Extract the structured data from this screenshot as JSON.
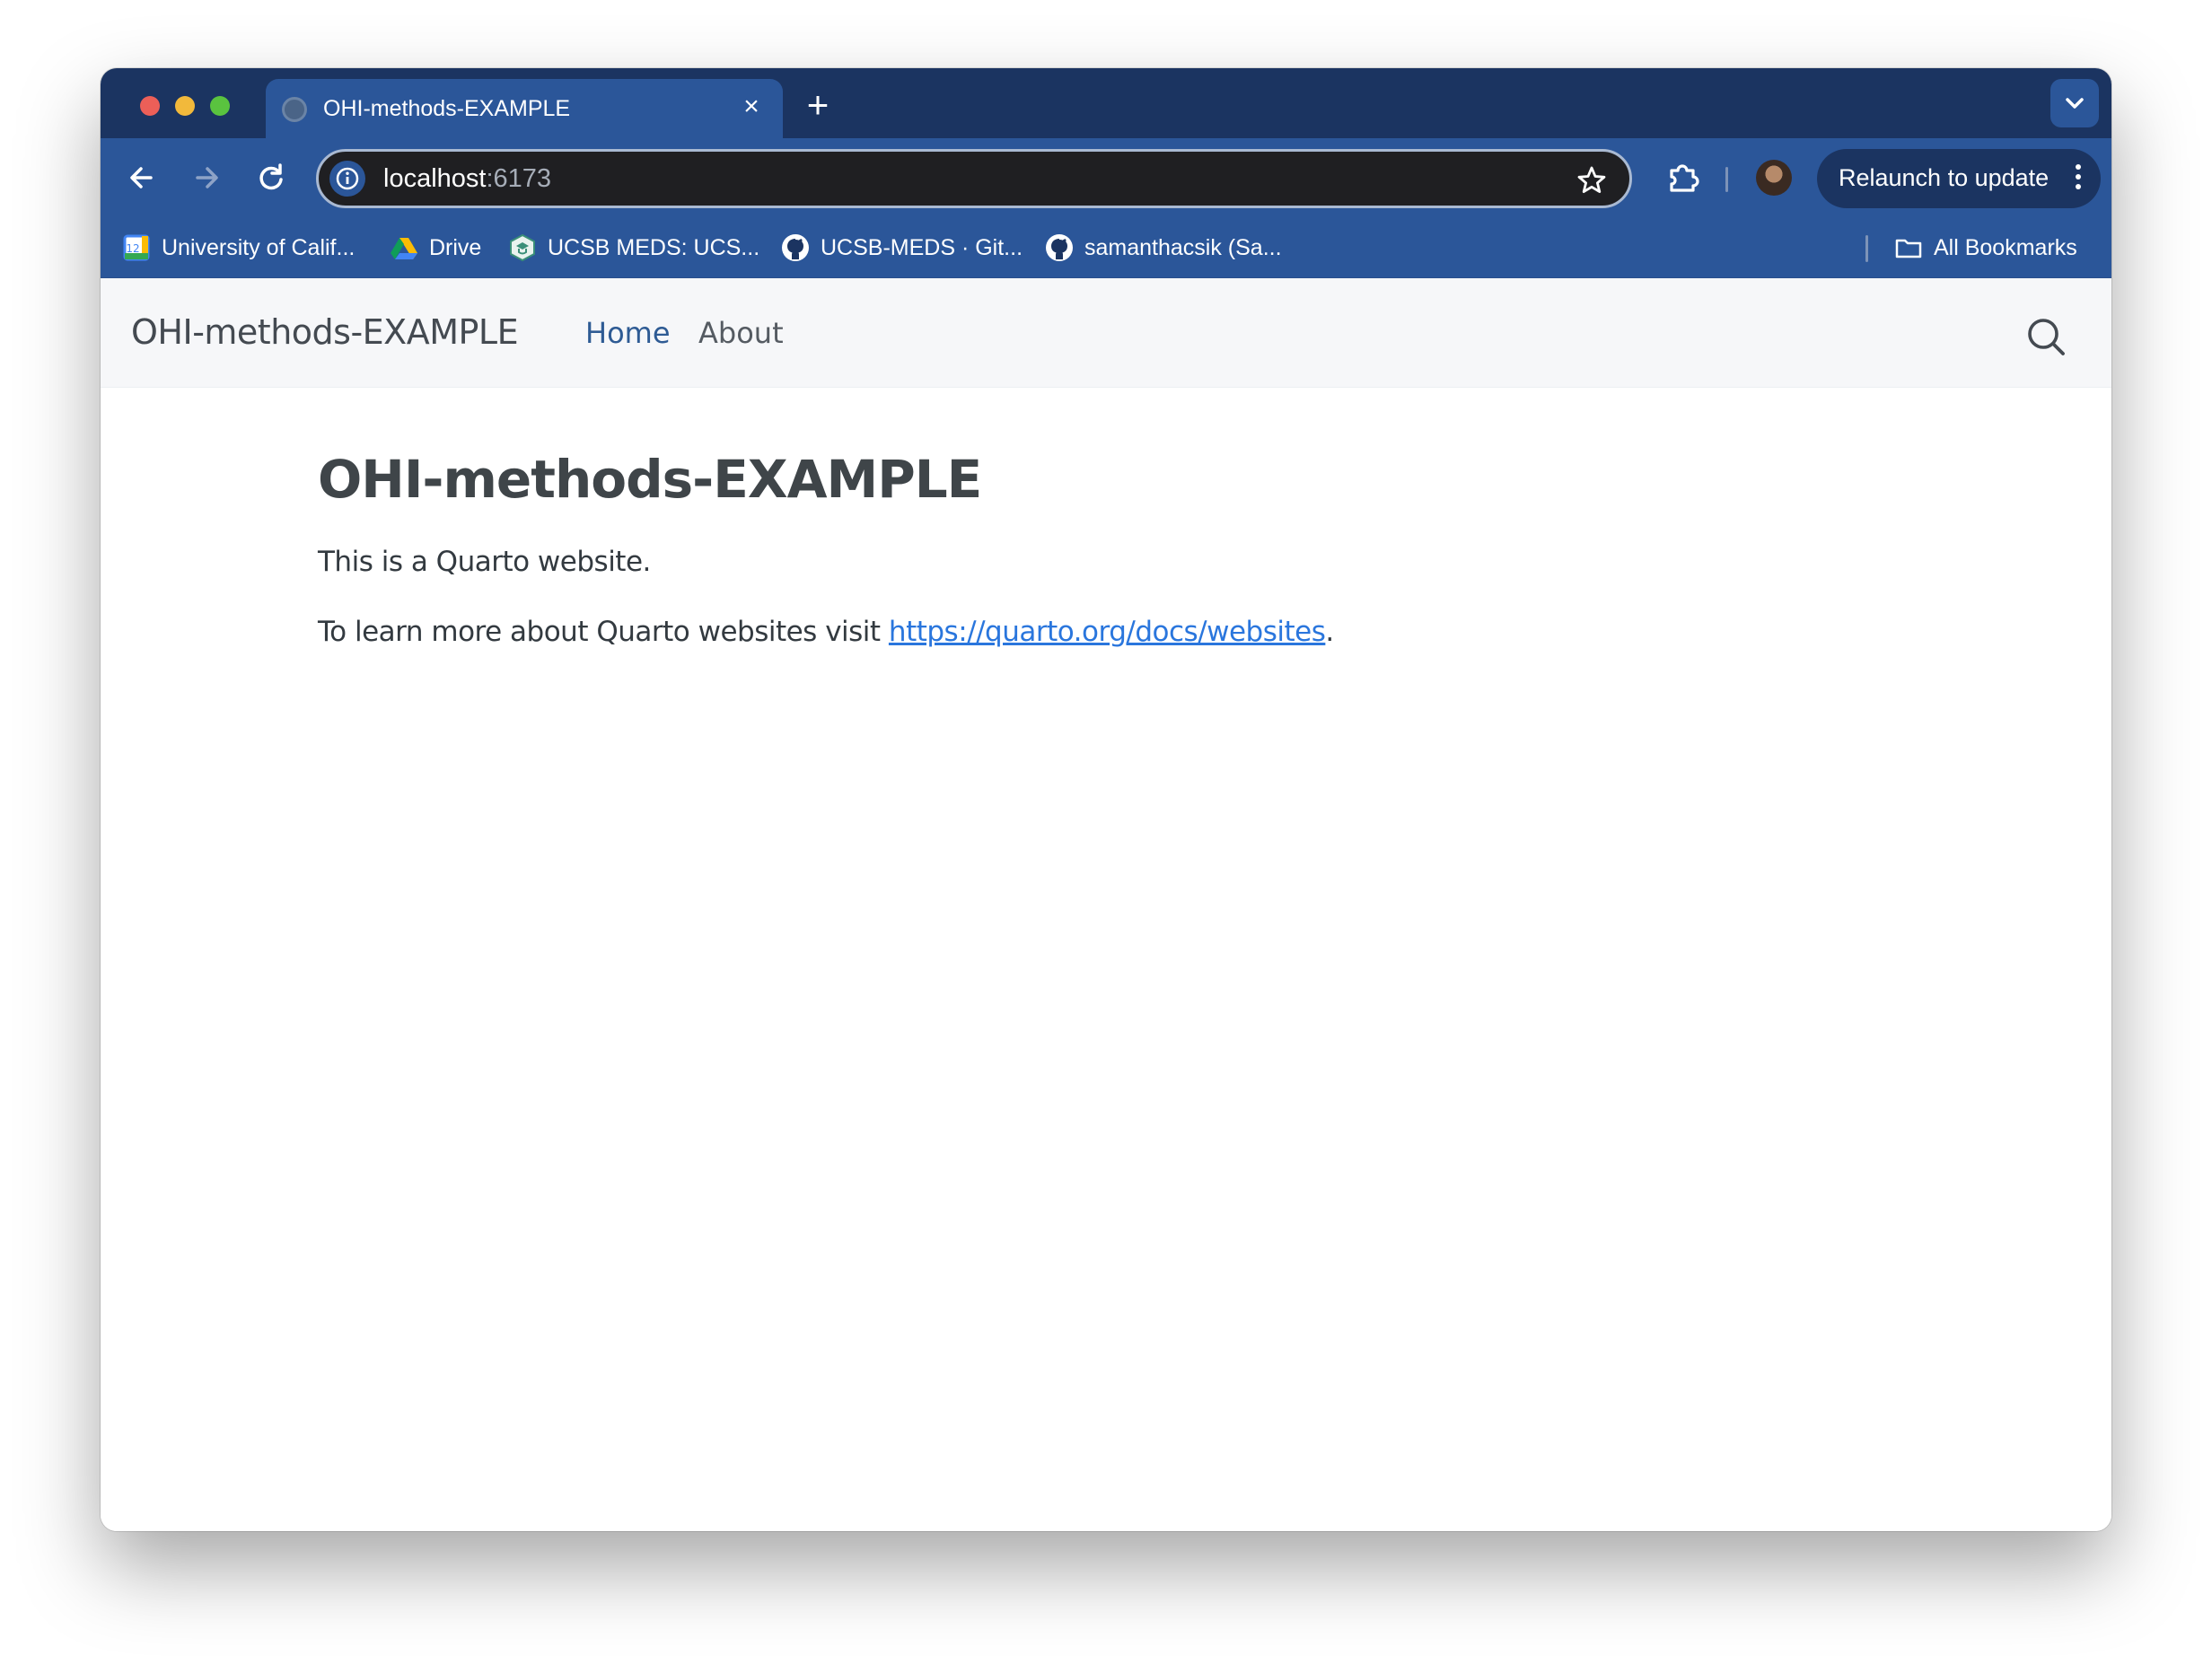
{
  "browser": {
    "tab": {
      "title": "OHI-methods-EXAMPLE",
      "close_glyph": "×"
    },
    "new_tab_glyph": "+",
    "address": {
      "host": "localhost",
      "port": ":6173"
    },
    "relaunch_label": "Relaunch to update",
    "bookmarks": [
      {
        "label": "University of Calif...",
        "icon": "calendar-icon"
      },
      {
        "label": "Drive",
        "icon": "google-drive-icon"
      },
      {
        "label": "UCSB MEDS: UCS...",
        "icon": "meds-logo-icon"
      },
      {
        "label": "UCSB-MEDS · Git...",
        "icon": "github-icon"
      },
      {
        "label": "samanthacsik (Sa...",
        "icon": "github-icon"
      }
    ],
    "all_bookmarks_label": "All Bookmarks",
    "colors": {
      "frame": "#1b3461",
      "toolbar": "#2b5699",
      "omnibox": "#1f1f22"
    }
  },
  "site": {
    "brand": "OHI-methods-EXAMPLE",
    "nav": [
      {
        "label": "Home",
        "active": true
      },
      {
        "label": "About",
        "active": false
      }
    ],
    "colors": {
      "active_nav": "#2e5b94",
      "link": "#2a76dd"
    }
  },
  "main": {
    "title": "OHI-methods-EXAMPLE",
    "paragraph1": "This is a Quarto website.",
    "paragraph2_prefix": "To learn more about Quarto websites visit ",
    "link_text": "https://quarto.org/docs/websites",
    "paragraph2_suffix": "."
  }
}
